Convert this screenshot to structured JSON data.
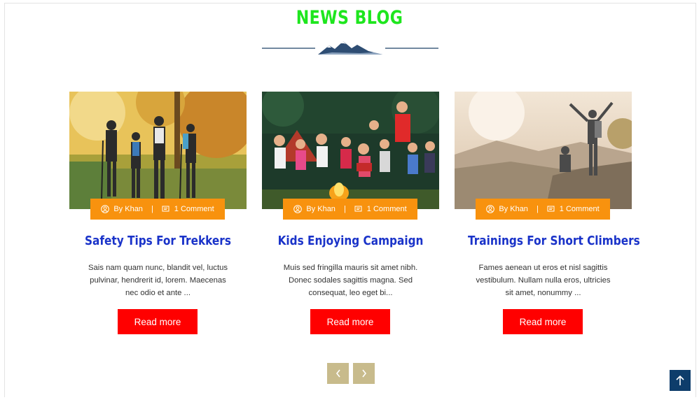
{
  "section": {
    "title": "NEWS BLOG"
  },
  "posts": [
    {
      "author": "By Khan",
      "comments": "1 Comment",
      "title": "Safety Tips For Trekkers",
      "excerpt": "Sais nam quam nunc, blandit vel, luctus pulvinar, hendrerit id, lorem. Maecenas nec odio et ante ...",
      "button": "Read more",
      "image": "hikers-in-autumn-forest"
    },
    {
      "author": "By Khan",
      "comments": "1 Comment",
      "title": "Kids Enjoying Campaign",
      "excerpt": "Muis sed fringilla mauris sit amet nibh. Donec sodales sagittis magna. Sed consequat, leo eget bi...",
      "button": "Read more",
      "image": "kids-around-campfire"
    },
    {
      "author": "By Khan",
      "comments": "1 Comment",
      "title": "Trainings For Short Climbers",
      "excerpt": "Fames aenean ut eros et nisl sagittis vestibulum. Nullam nulla eros, ultricies sit amet, nonummy ...",
      "button": "Read more",
      "image": "climbers-on-mountain-top"
    }
  ],
  "carousel": {
    "prev_icon": "chevron-left-icon",
    "next_icon": "chevron-right-icon"
  },
  "colors": {
    "title": "#1ee61e",
    "meta": "#f8920e",
    "post_title": "#1a33c9",
    "button": "#ff0000",
    "nav": "#c8bb8c",
    "to_top": "#0e3d6b"
  }
}
